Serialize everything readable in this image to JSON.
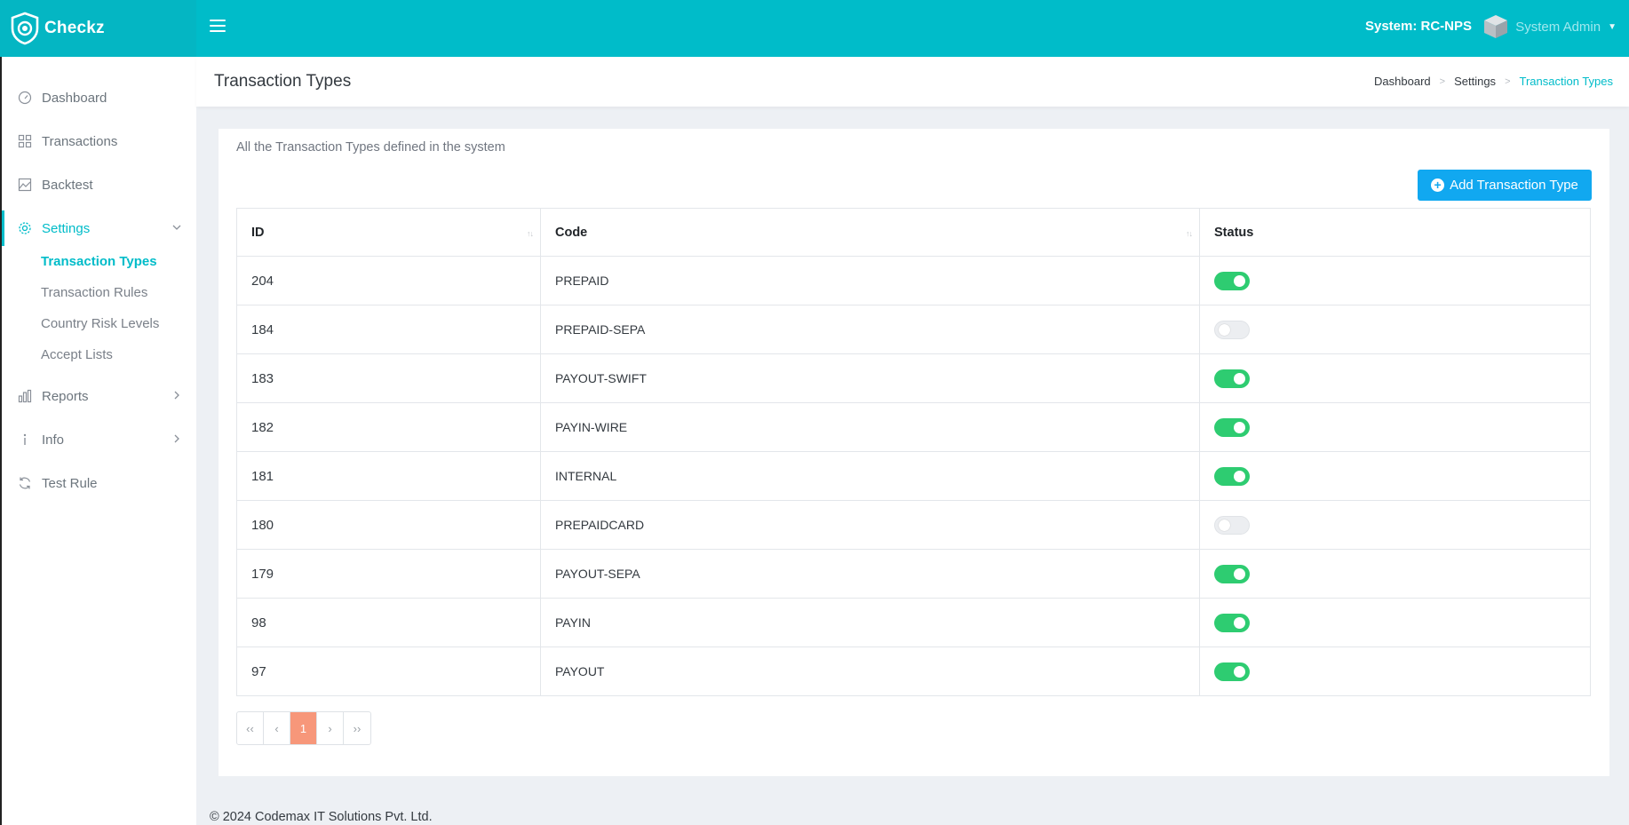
{
  "brand": {
    "name": "Checkz"
  },
  "topbar": {
    "system": "System: RC-NPS",
    "user": "System Admin"
  },
  "sidebar": {
    "items": [
      {
        "label": "Dashboard",
        "icon": "dashboard-gauge-icon"
      },
      {
        "label": "Transactions",
        "icon": "grid-icon"
      },
      {
        "label": "Backtest",
        "icon": "chart-image-icon"
      },
      {
        "label": "Settings",
        "icon": "gear-icon"
      },
      {
        "label": "Reports",
        "icon": "bar-chart-icon"
      },
      {
        "label": "Info",
        "icon": "info-icon"
      },
      {
        "label": "Test Rule",
        "icon": "refresh-icon"
      }
    ],
    "settings_sub": [
      "Transaction Types",
      "Transaction Rules",
      "Country Risk Levels",
      "Accept Lists"
    ]
  },
  "page": {
    "title": "Transaction Types",
    "breadcrumb": [
      "Dashboard",
      "Settings",
      "Transaction Types"
    ],
    "description": "All the Transaction Types defined in the system",
    "add_button": "Add Transaction Type"
  },
  "table": {
    "headers": [
      "ID",
      "Code",
      "Status"
    ],
    "rows": [
      {
        "id": "204",
        "code": "PREPAID",
        "active": true
      },
      {
        "id": "184",
        "code": "PREPAID-SEPA",
        "active": false
      },
      {
        "id": "183",
        "code": "PAYOUT-SWIFT",
        "active": true
      },
      {
        "id": "182",
        "code": "PAYIN-WIRE",
        "active": true
      },
      {
        "id": "181",
        "code": "INTERNAL",
        "active": true
      },
      {
        "id": "180",
        "code": "PREPAIDCARD",
        "active": false
      },
      {
        "id": "179",
        "code": "PAYOUT-SEPA",
        "active": true
      },
      {
        "id": "98",
        "code": "PAYIN",
        "active": true
      },
      {
        "id": "97",
        "code": "PAYOUT",
        "active": true
      }
    ]
  },
  "pagination": {
    "first": "‹‹",
    "prev": "‹",
    "current": "1",
    "next": "›",
    "last": "››"
  },
  "footer": {
    "text": "© 2024 Codemax IT Solutions Pvt. Ltd."
  },
  "colors": {
    "primary": "#00bcc9",
    "button": "#11a8f0",
    "toggle_on": "#2ecc71",
    "page_active": "#f7977a"
  }
}
